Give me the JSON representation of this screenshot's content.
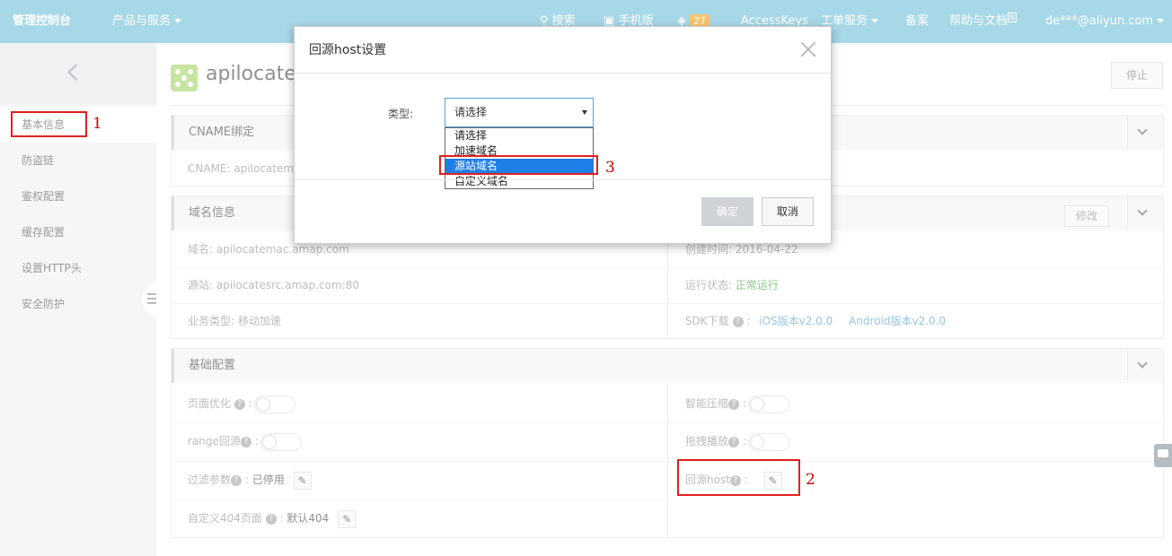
{
  "topbar": {
    "console": "管理控制台",
    "products": "产品与服务",
    "search": "搜索",
    "mobile": "手机版",
    "notif_count": "27",
    "accesskeys": "AccessKeys",
    "tickets": "工单服务",
    "beian": "备案",
    "help": "帮助与文档",
    "help_badge": "N",
    "user": "de***@aliyun.com"
  },
  "sidebar": {
    "items": [
      "基本信息",
      "防盗链",
      "鉴权配置",
      "缓存配置",
      "设置HTTP头",
      "安全防护"
    ]
  },
  "main": {
    "title": "apilocatemac.amap.com",
    "stop_label": "停止",
    "cname": {
      "heading": "CNAME绑定",
      "row": "CNAME: apilocatemac"
    },
    "domain": {
      "heading": "域名信息",
      "edit_label": "修改",
      "name": "域名: apilocatemac.amap.com",
      "created": "创建时间: 2016-04-22",
      "origin": "源站: apilocatesrc.amap.com:80",
      "status_label": "运行状态: ",
      "status_value": "正常运行",
      "biz_type": "业务类型: 移动加速",
      "sdk_label": "SDK下载",
      "sdk_ios": "iOS版本v2.0.0",
      "sdk_android": "Android版本v2.0.0"
    },
    "basic": {
      "heading": "基础配置",
      "page_opt": "页面优化",
      "smart_compress": "智能压缩",
      "range_origin": "range回源",
      "drag_play": "拖拽播放",
      "filter_params": "过滤参数",
      "filter_value": "已停用",
      "origin_host": "回源host",
      "custom_404": "自定义404页面",
      "custom_404_value": "默认404"
    }
  },
  "modal": {
    "title": "回源host设置",
    "type_label": "类型:",
    "select_value": "请选择",
    "options": [
      "请选择",
      "加速域名",
      "源站域名",
      "自定义域名"
    ],
    "selected_index": 2,
    "ok_label": "确定",
    "cancel_label": "取消"
  },
  "annotations": [
    "1",
    "2",
    "3"
  ]
}
